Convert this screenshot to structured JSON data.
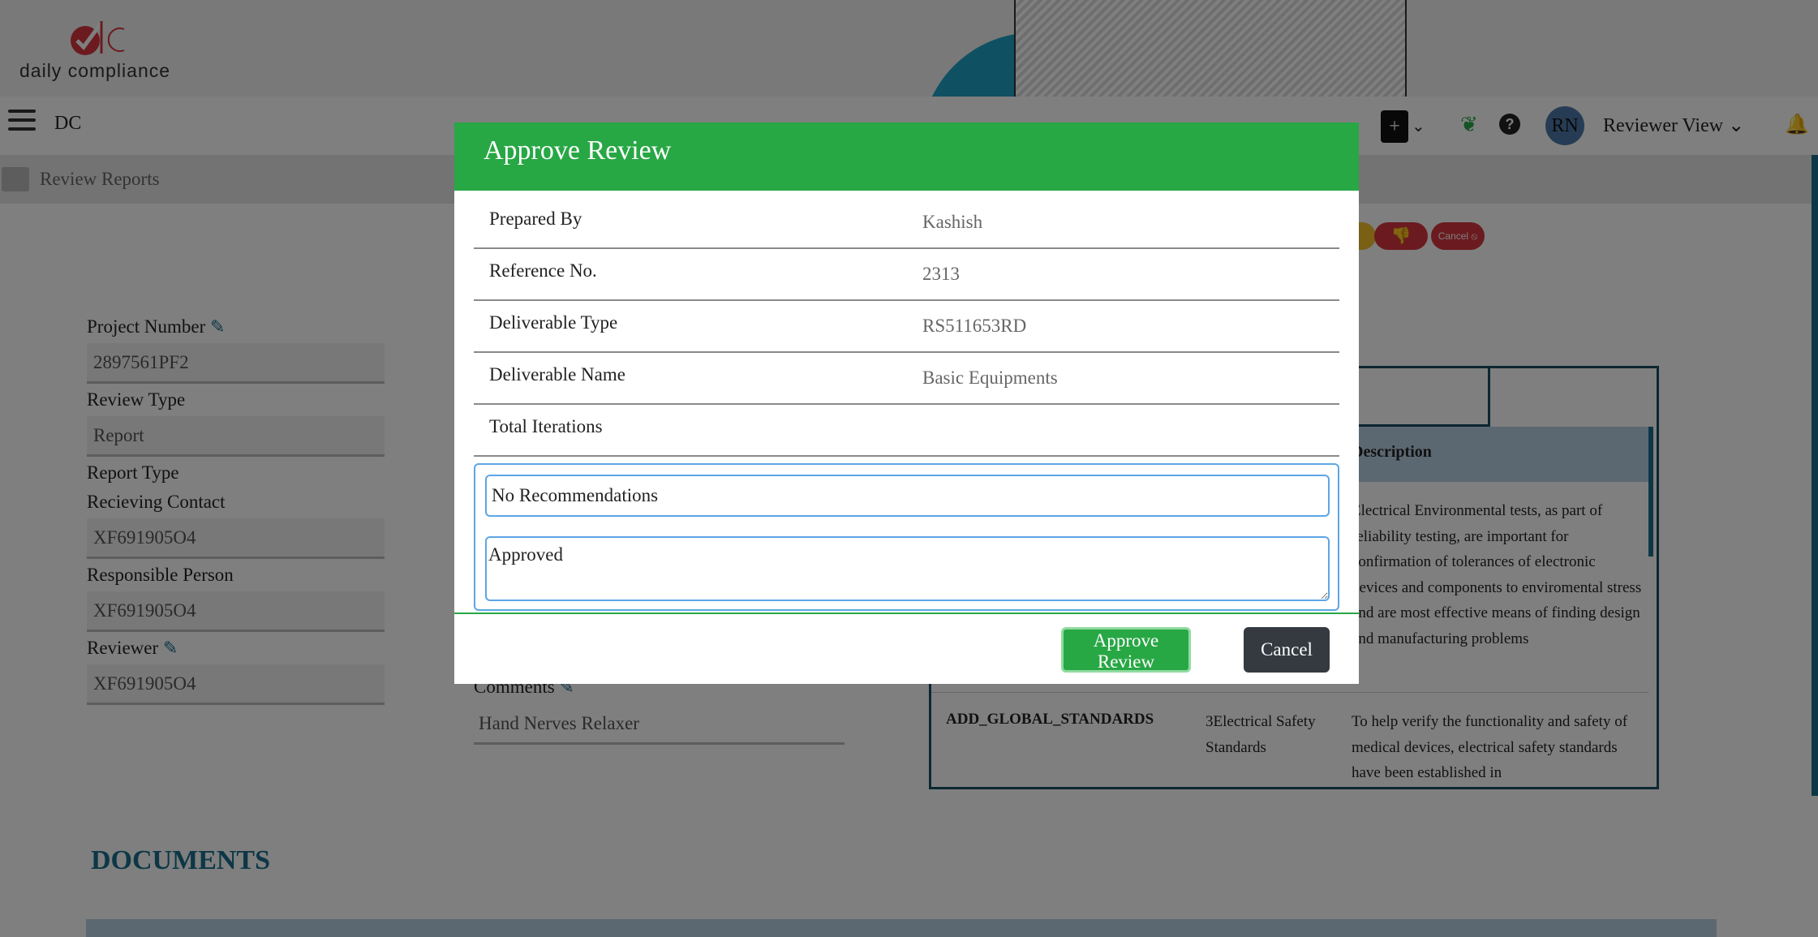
{
  "brand": {
    "logo_text": "daily compliance"
  },
  "navbar": {
    "app_label": "DC",
    "avatar_initials": "RN",
    "view_label": "Reviewer View"
  },
  "subbar": {
    "title": "Review Reports"
  },
  "left_form": {
    "project_number_label": "Project Number",
    "project_number_value": "2897561PF2",
    "review_type_label": "Review Type",
    "review_type_value": "Report",
    "report_type_label": "Report Type",
    "receiving_contact_label": "Recieving Contact",
    "receiving_contact_value": "XF691905O4",
    "responsible_person_label": "Responsible Person",
    "responsible_person_value": "XF691905O4",
    "reviewer_label": "Reviewer",
    "reviewer_value": "XF691905O4"
  },
  "comments": {
    "label": "Comments",
    "value": "Hand Nerves Relaxer"
  },
  "actions": {
    "cancel_pill": "Cancel"
  },
  "standards_table": {
    "desc_header": "Description",
    "row1_desc": "Electrical Environmental tests, as part of reliability testing, are important for confirmation of tolerances of electronic devices and components to enviromental stress and are most effective means of finding design and manufacturing problems",
    "row2_code": "ADD_GLOBAL_STANDARDS",
    "row2_standard": "3Electrical Safety Standards",
    "row2_desc": "To help verify the functionality and safety of medical devices, electrical safety standards have been established in"
  },
  "documents": {
    "heading": "DOCUMENTS"
  },
  "modal": {
    "title": "Approve Review",
    "rows": [
      {
        "label": "Prepared By",
        "value": "Kashish"
      },
      {
        "label": "Reference No.",
        "value": "2313"
      },
      {
        "label": "Deliverable Type",
        "value": "RS511653RD"
      },
      {
        "label": "Deliverable Name",
        "value": "Basic Equipments"
      },
      {
        "label": "Total Iterations",
        "value": ""
      }
    ],
    "recommendation_value": "No Recommendations",
    "comment_value": "Approved",
    "approve_button": "Approve Review",
    "cancel_button": "Cancel"
  },
  "colors": {
    "primary_green": "#28a745",
    "accent_blue": "#1a6f8c",
    "danger_red": "#d7363e",
    "dark_button": "#343a40"
  }
}
